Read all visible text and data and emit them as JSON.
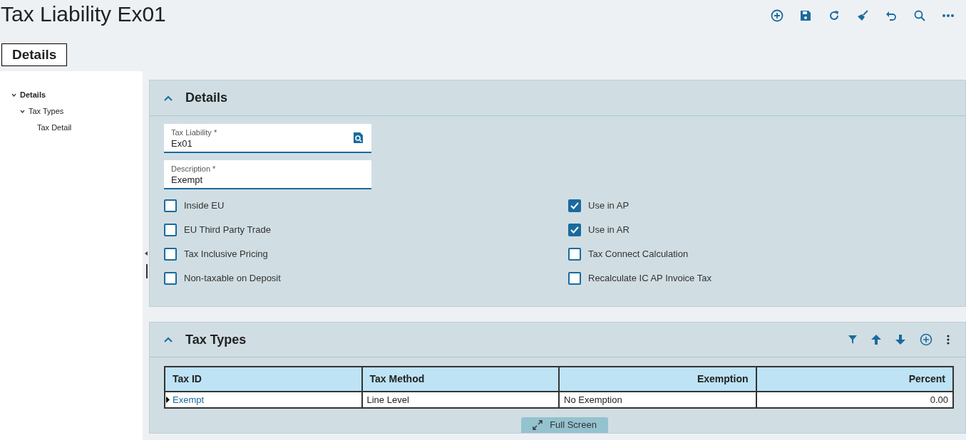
{
  "title": "Tax Liability Ex01",
  "tab": {
    "label": "Details",
    "selected": true
  },
  "tree": [
    {
      "label": "Details",
      "expanded": true,
      "children": [
        {
          "label": "Tax Types",
          "expanded": true,
          "children": [
            {
              "label": "Tax Detail"
            }
          ]
        }
      ]
    }
  ],
  "details": {
    "title": "Details",
    "expanded": true,
    "fields": [
      {
        "label": "Tax Liability *",
        "value": "Ex01",
        "kind": "lookup"
      },
      {
        "label": "Description *",
        "value": "Exempt",
        "kind": "text"
      }
    ],
    "checkboxes_left": [
      {
        "label": "Inside EU",
        "checked": false
      },
      {
        "label": "EU Third Party Trade",
        "checked": false
      },
      {
        "label": "Tax Inclusive Pricing",
        "checked": false
      },
      {
        "label": "Non-taxable on Deposit",
        "checked": false
      }
    ],
    "checkboxes_right": [
      {
        "label": "Use in AP",
        "checked": true
      },
      {
        "label": "Use in AR",
        "checked": true
      },
      {
        "label": "Tax Connect Calculation",
        "checked": false
      },
      {
        "label": "Recalculate IC AP Invoice Tax",
        "checked": false
      }
    ]
  },
  "tax_types": {
    "title": "Tax Types",
    "expanded": true,
    "columns": [
      "Tax ID",
      "Tax Method",
      "Exemption",
      "Percent"
    ],
    "rows": [
      {
        "selected": true,
        "cells": [
          "Exempt",
          "Line Level",
          "No Exemption",
          "0.00"
        ]
      }
    ],
    "full_screen_button": "Full Screen"
  }
}
